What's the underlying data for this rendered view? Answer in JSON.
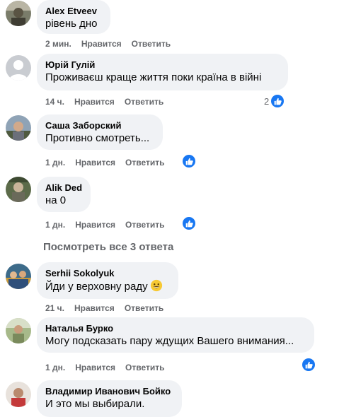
{
  "comments": [
    {
      "author": "Alex Etveev",
      "text": "рівень дно",
      "time": "2 мин.",
      "like_label": "Нравится",
      "reply_label": "Ответить"
    },
    {
      "author": "Юрій Гулій",
      "text": "Проживаєш краще життя поки країна в війні",
      "time": "14 ч.",
      "like_label": "Нравится",
      "reply_label": "Ответить",
      "reaction_count": "2"
    },
    {
      "author": "Саша Заборский",
      "text": "Противно смотреть...",
      "time": "1 дн.",
      "like_label": "Нравится",
      "reply_label": "Ответить"
    },
    {
      "author": "Alik Ded",
      "text": "на 0",
      "time": "1 дн.",
      "like_label": "Нравится",
      "reply_label": "Ответить"
    },
    {
      "author": "Serhii Sokolyuk",
      "text": "Йди у верховну раду",
      "time": "21 ч.",
      "like_label": "Нравится",
      "reply_label": "Ответить"
    },
    {
      "author": "Наталья Бурко",
      "text": "Могу подсказать пару ждущих Вашего внимания...",
      "time": "1 дн.",
      "like_label": "Нравится",
      "reply_label": "Ответить"
    },
    {
      "author": "Владимир Иванович Бойко",
      "text": "И это мы выбирали."
    }
  ],
  "view_replies": "Посмотреть все 3 ответа",
  "colors": {
    "bubble": "#f0f2f5",
    "meta": "#65676b",
    "like": "#1877f2"
  },
  "icons": {
    "like": "thumbs-up-icon",
    "laugh": "grinning-emoji-icon",
    "default_avatar": "user-silhouette-icon"
  }
}
